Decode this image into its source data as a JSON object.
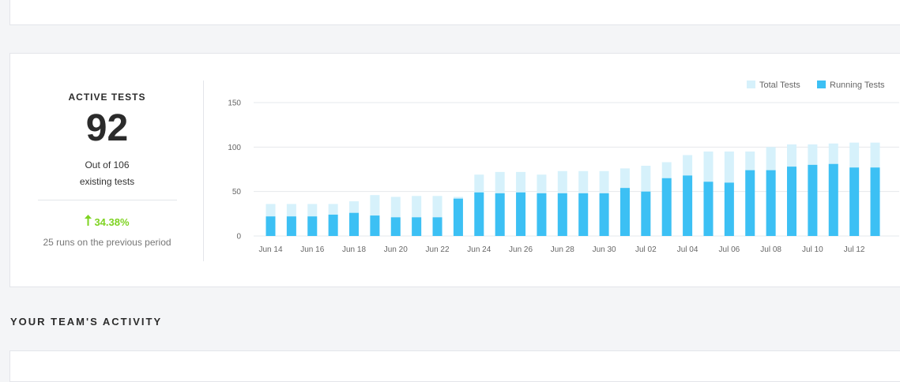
{
  "stats": {
    "title": "ACTIVE TESTS",
    "value": "92",
    "desc_line1": "Out of 106",
    "desc_line2": "existing tests",
    "change": "34.38%",
    "change_icon": "arrow-up-icon",
    "previous": "25 runs on the previous period",
    "change_color": "#7ed321"
  },
  "section": {
    "title": "YOUR TEAM'S ACTIVITY"
  },
  "colors": {
    "total": "#d6f1fb",
    "running": "#3cc0f4",
    "grid": "#e6e8ec",
    "tick": "#666666"
  },
  "chart_data": {
    "type": "bar",
    "stacked": "overlay",
    "legend_position": "top-right",
    "ylim": [
      0,
      150
    ],
    "yticks": [
      0,
      50,
      100,
      150
    ],
    "grid": true,
    "categories": [
      "Jun 14",
      "Jun 15",
      "Jun 16",
      "Jun 17",
      "Jun 18",
      "Jun 19",
      "Jun 20",
      "Jun 21",
      "Jun 22",
      "Jun 23",
      "Jun 24",
      "Jun 25",
      "Jun 26",
      "Jun 27",
      "Jun 28",
      "Jun 29",
      "Jun 30",
      "Jul 01",
      "Jul 02",
      "Jul 03",
      "Jul 04",
      "Jul 05",
      "Jul 06",
      "Jul 07",
      "Jul 08",
      "Jul 09",
      "Jul 10",
      "Jul 11",
      "Jul 12",
      "Jul 13"
    ],
    "xtick_labels": [
      "Jun 14",
      "",
      "Jun 16",
      "",
      "Jun 18",
      "",
      "Jun 20",
      "",
      "Jun 22",
      "",
      "Jun 24",
      "",
      "Jun 26",
      "",
      "Jun 28",
      "",
      "Jun 30",
      "",
      "Jul 02",
      "",
      "Jul 04",
      "",
      "Jul 06",
      "",
      "Jul 08",
      "",
      "Jul 10",
      "",
      "Jul 12",
      ""
    ],
    "series": [
      {
        "name": "Total Tests",
        "values": [
          36,
          36,
          36,
          36,
          39,
          46,
          44,
          45,
          45,
          44,
          69,
          72,
          72,
          69,
          73,
          73,
          73,
          76,
          79,
          83,
          91,
          95,
          95,
          95,
          100,
          103,
          103,
          104,
          105,
          105
        ]
      },
      {
        "name": "Running Tests",
        "values": [
          22,
          22,
          22,
          24,
          26,
          23,
          21,
          21,
          21,
          42,
          49,
          48,
          49,
          48,
          48,
          48,
          48,
          54,
          50,
          65,
          68,
          61,
          60,
          74,
          74,
          78,
          80,
          81,
          77,
          77
        ]
      }
    ]
  }
}
